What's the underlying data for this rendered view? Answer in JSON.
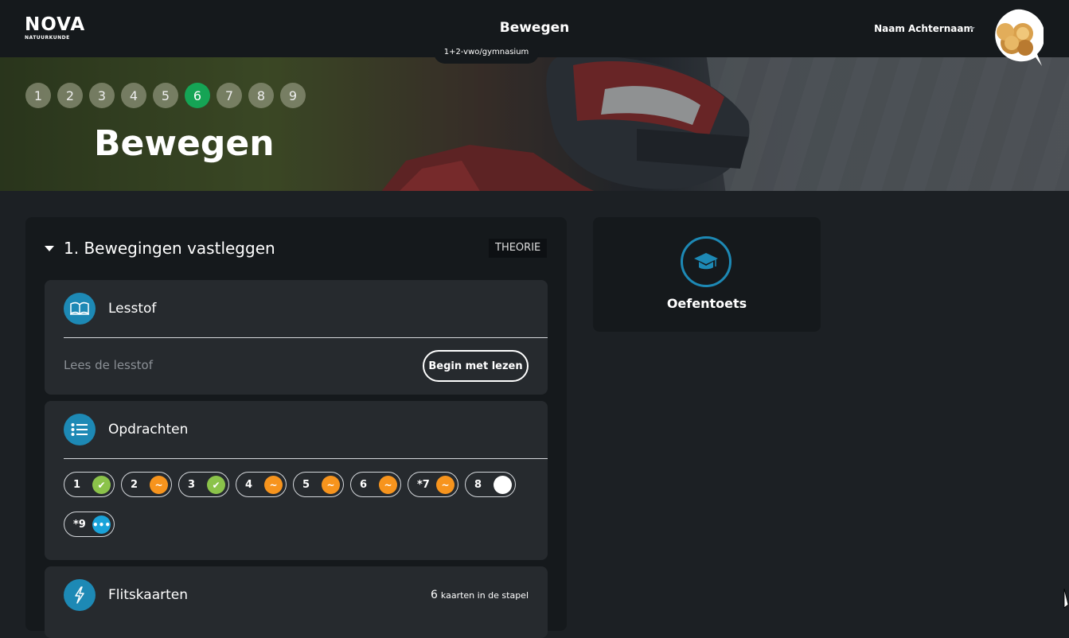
{
  "header": {
    "logo_main": "NOVA",
    "logo_sub": "NATUURKUNDE",
    "title": "Bewegen",
    "level": "1+2-vwo/gymnasium",
    "user_name": "Naam Achternaam"
  },
  "hero": {
    "chapters": [
      "1",
      "2",
      "3",
      "4",
      "5",
      "6",
      "7",
      "8",
      "9"
    ],
    "active_chapter": "6",
    "title": "Bewegen"
  },
  "section": {
    "title": "1.  Bewegingen vastleggen",
    "badge": "THEORIE"
  },
  "lesstof": {
    "title": "Lesstof",
    "description": "Lees de lesstof",
    "button": "Begin met lezen",
    "icon": "book-icon"
  },
  "opdrachten": {
    "title": "Opdrachten",
    "icon": "list-icon",
    "items": [
      {
        "label": "1",
        "status": "done"
      },
      {
        "label": "2",
        "status": "partial"
      },
      {
        "label": "3",
        "status": "done"
      },
      {
        "label": "4",
        "status": "partial"
      },
      {
        "label": "5",
        "status": "partial"
      },
      {
        "label": "6",
        "status": "partial"
      },
      {
        "label": "*7",
        "status": "partial"
      },
      {
        "label": "8",
        "status": "open"
      },
      {
        "label": "*9",
        "status": "pending"
      }
    ]
  },
  "flitskaarten": {
    "title": "Flitskaarten",
    "count": "6",
    "count_label": "kaarten in de stapel",
    "icon": "lightning-icon"
  },
  "oefentoets": {
    "label": "Oefentoets",
    "icon": "graduation-cap-icon"
  },
  "colors": {
    "accent_blue": "#1d89b5",
    "active_green": "#15a455",
    "done": "#8bc34a",
    "partial": "#f7941d",
    "pending": "#1aa3d9"
  }
}
